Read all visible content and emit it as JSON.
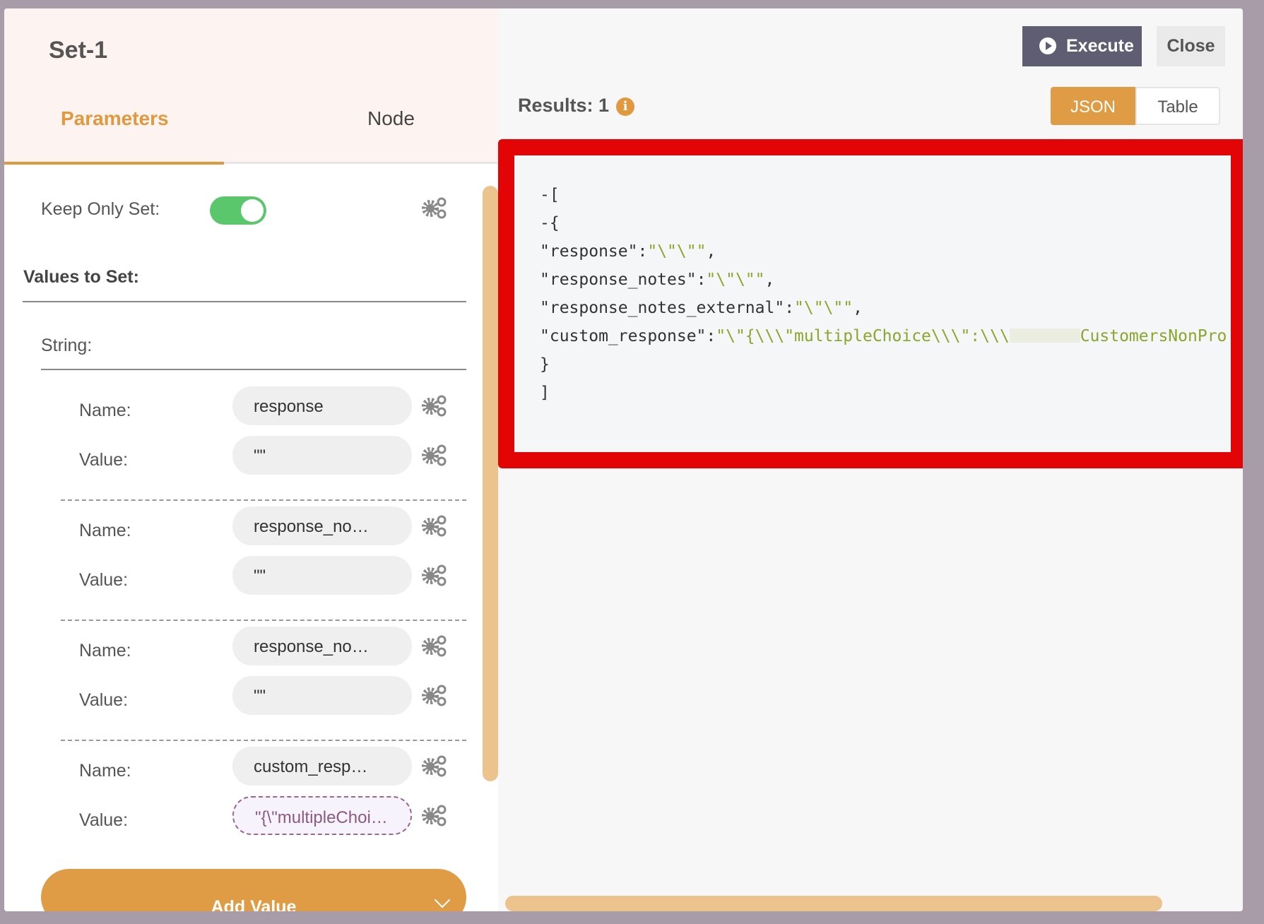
{
  "node": {
    "title": "Set-1",
    "tabs": [
      "Parameters",
      "Node"
    ]
  },
  "parameters": {
    "keep_only_set_label": "Keep Only Set:",
    "keep_only_set": true,
    "values_to_set_label": "Values to Set:",
    "string_label": "String:",
    "name_label": "Name:",
    "value_label": "Value:",
    "entries": [
      {
        "name": "response",
        "value": "\"\""
      },
      {
        "name": "response_no…",
        "value": "\"\""
      },
      {
        "name": "response_no…",
        "value": "\"\""
      },
      {
        "name": "custom_resp…",
        "value": "\"{\\\"multipleChoi…"
      }
    ],
    "add_value_label": "Add Value"
  },
  "output": {
    "execute_label": "Execute",
    "close_label": "Close",
    "results_label": "Results: 1",
    "view_modes": [
      "JSON",
      "Table"
    ],
    "active_view": "JSON",
    "json_lines": {
      "open_array": "-[",
      "open_obj": "-{",
      "k1": "\"response\"",
      "v1": "\"\\\"\\\"\"",
      "k2": "\"response_notes\"",
      "v2": "\"\\\"\\\"\"",
      "k3": "\"response_notes_external\"",
      "v3": "\"\\\"\\\"\"",
      "k4": "\"custom_response\"",
      "v4a": "\"\\\"{\\\\\\\"multipleChoice\\\\\\\":\\\\\\",
      "v4b": "CustomersNonPro",
      "close_obj": "}",
      "close_array": "]"
    }
  },
  "colors": {
    "accent": "#df9c44",
    "highlight": "#e30505",
    "toggle_on": "#5ac76d"
  }
}
